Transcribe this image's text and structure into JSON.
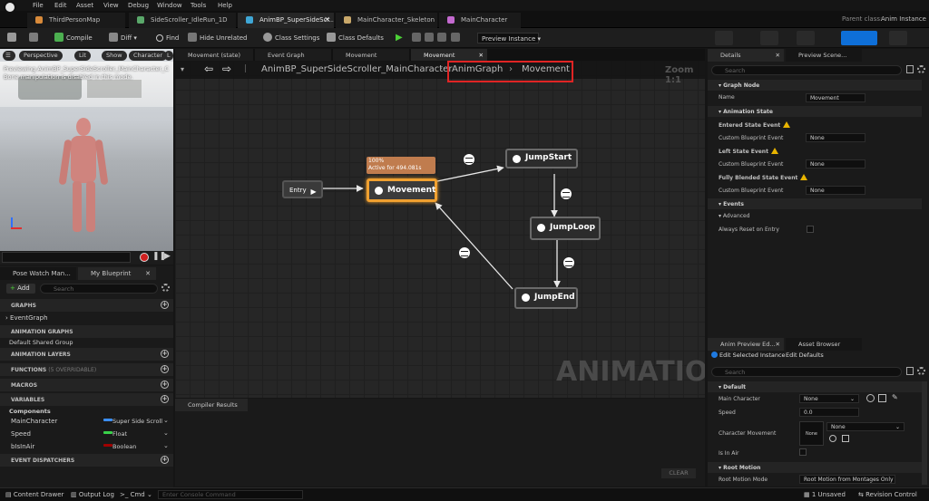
{
  "menu": [
    "File",
    "Edit",
    "Asset",
    "View",
    "Debug",
    "Window",
    "Tools",
    "Help"
  ],
  "tabs": [
    {
      "label": "ThirdPersonMap"
    },
    {
      "label": "SideScroller_IdleRun_1D"
    },
    {
      "label": "AnimBP_SuperSideScr..."
    },
    {
      "label": "MainCharacter_Skeleton"
    },
    {
      "label": "MainCharacter"
    }
  ],
  "parent_class": {
    "label": "Parent class:",
    "value": "Anim Instance"
  },
  "toolbar": {
    "compile": "Compile",
    "diff": "Diff",
    "find": "Find",
    "hide_unrelated": "Hide Unrelated",
    "class_settings": "Class Settings",
    "class_defaults": "Class Defaults",
    "preview_instance": "Preview Instance"
  },
  "viewport": {
    "perspective": "Perspective",
    "lit": "Lit",
    "show": "Show",
    "character": "Character",
    "lod": "L",
    "line1": "Previewing AnimBP_SuperSideScroller_MainCharacter_C",
    "line2": "Bone manipulation is disabled in this mode."
  },
  "left_tabs": {
    "pose_watch": "Pose Watch Man...",
    "my_blueprint": "My Blueprint"
  },
  "my_blueprint": {
    "add": "Add",
    "search_placeholder": "Search",
    "graphs": "GRAPHS",
    "event_graph": "EventGraph",
    "anim_graphs": "ANIMATION GRAPHS",
    "default_shared": "Default Shared Group",
    "anim_layers": "ANIMATION LAYERS",
    "functions": "FUNCTIONS",
    "functions_count": "(5 OVERRIDABLE)",
    "macros": "MACROS",
    "variables": "VARIABLES",
    "components": "Components",
    "vars": [
      {
        "name": "MainCharacter",
        "type": "Super Side Scroll",
        "color": "#3b8ef5"
      },
      {
        "name": "Speed",
        "type": "Float",
        "color": "#39d14a"
      },
      {
        "name": "bIsInAir",
        "type": "Boolean",
        "color": "#a00000"
      }
    ],
    "event_dispatchers": "EVENT DISPATCHERS"
  },
  "graph_tabs": [
    "Movement (state)",
    "Event Graph",
    "Movement",
    "Movement"
  ],
  "breadcrumb": {
    "root": "AnimBP_SuperSideScroller_MainCharacter",
    "anim_graph": "AnimGraph",
    "movement": "Movement",
    "zoom": "Zoom 1:1"
  },
  "watermark": "ANIMATION",
  "nodes": {
    "entry": "Entry",
    "movement": "Movement",
    "jump_start": "JumpStart",
    "jump_loop": "JumpLoop",
    "jump_end": "JumpEnd",
    "active_pct": "100%",
    "active_for": "Active for 494.081s"
  },
  "compiler": {
    "tab": "Compiler Results",
    "clear": "CLEAR"
  },
  "details": {
    "tab": "Details",
    "preview_tab": "Preview Scene...",
    "search_placeholder": "Search",
    "graph_node": "Graph Node",
    "name_label": "Name",
    "name_value": "Movement",
    "animation_state": "Animation State",
    "entered": "Entered State Event",
    "left": "Left State Event",
    "fully_blended": "Fully Blended State Event",
    "custom_bp": "Custom Blueprint Event",
    "none": "None",
    "events": "Events",
    "advanced": "Advanced",
    "always_reset": "Always Reset on Entry"
  },
  "preview_editor": {
    "tab": "Anim Preview Ed...",
    "asset_browser": "Asset Browser",
    "edit_selected": "Edit Selected Instance",
    "edit_defaults": "Edit Defaults",
    "search_placeholder": "Search",
    "default": "Default",
    "main_character": "Main Character",
    "none": "None",
    "speed": "Speed",
    "speed_value": "0.0",
    "character_movement": "Character Movement",
    "in_air": "Is In Air",
    "root_motion": "Root Motion",
    "root_motion_mode": "Root Motion Mode",
    "root_motion_value": "Root Motion from Montages Only"
  },
  "status": {
    "content_drawer": "Content Drawer",
    "output_log": "Output Log",
    "cmd": "Cmd",
    "console_placeholder": "Enter Console Command",
    "unsaved": "1 Unsaved",
    "revision": "Revision Control"
  }
}
